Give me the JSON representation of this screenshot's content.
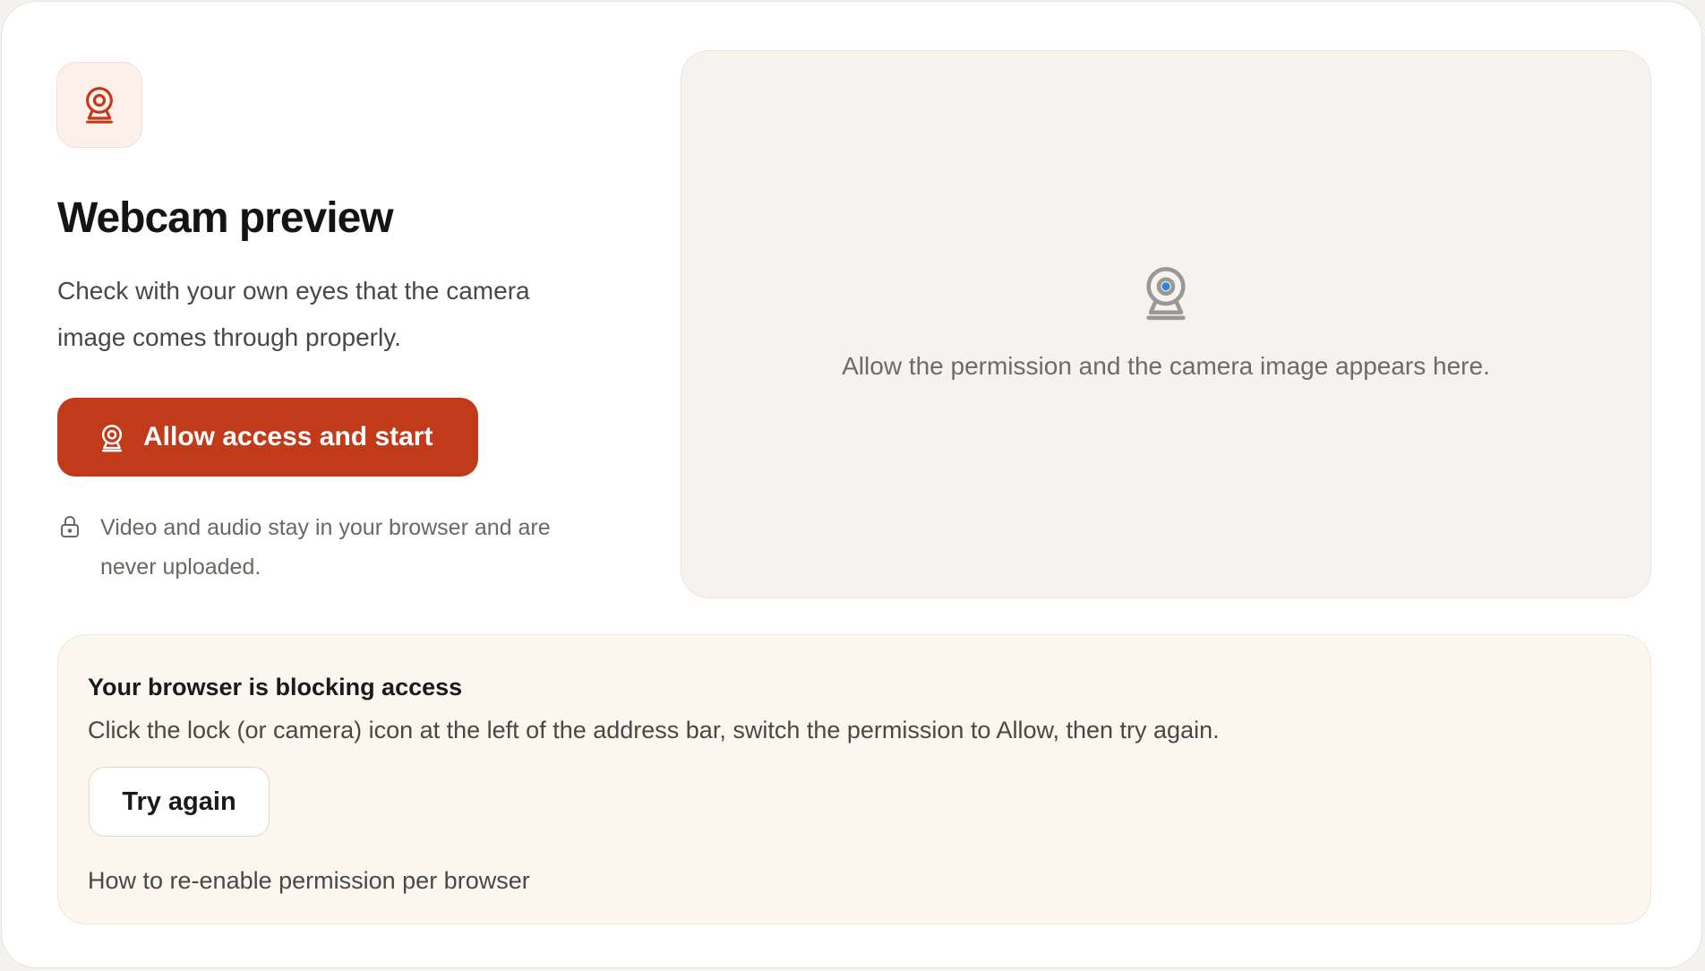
{
  "header": {
    "title": "Webcam preview",
    "description": "Check with your own eyes that the camera image comes through properly."
  },
  "actions": {
    "start_label": "Allow access and start"
  },
  "privacy": {
    "note": "Video and audio stay in your browser and are never uploaded."
  },
  "preview": {
    "placeholder": "Allow the permission and the camera image appears here."
  },
  "banner": {
    "title": "Your browser is blocking access",
    "text": "Click the lock (or camera) icon at the left of the address bar, switch the permission to Allow, then try again.",
    "retry_label": "Try again",
    "help_link": "How to re-enable permission per browser"
  },
  "icons": {
    "header": "webcam-icon",
    "button": "webcam-icon",
    "privacy": "lock-icon",
    "preview": "webcam-icon"
  },
  "colors": {
    "accent": "#c13a19",
    "preview_bg": "#f6f2ef",
    "banner_bg": "#fcf7ee",
    "preview_lens": "#2f86d6"
  }
}
